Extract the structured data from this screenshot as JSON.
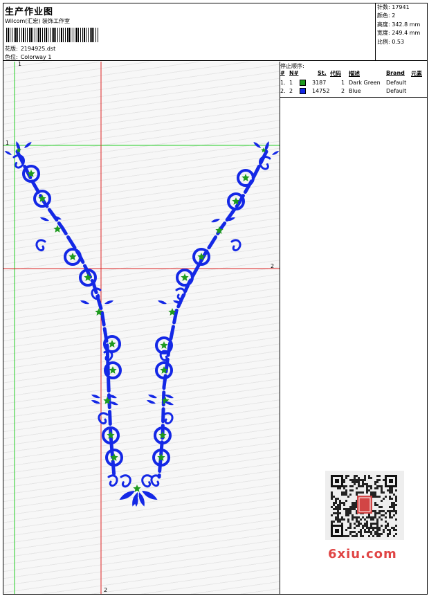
{
  "header": {
    "title": "生产作业图",
    "subtitle": "Wilcom(汇宏) 装饰工作室",
    "design_label": "花版:",
    "design_file": "2194925.dst",
    "colorway_label": "色位:",
    "colorway": "Colorway 1"
  },
  "stats": [
    {
      "label": "针数:",
      "value": "17941"
    },
    {
      "label": "颜色:",
      "value": "2"
    },
    {
      "label": "高度:",
      "value": "342.8 mm"
    },
    {
      "label": "宽度:",
      "value": "249.4 mm"
    },
    {
      "label": "比例:",
      "value": "0.53"
    }
  ],
  "stop_sequence": {
    "title": "停止顺序:",
    "columns": [
      "#",
      "N#",
      "St.",
      "代码",
      "描述",
      "Brand",
      "元素"
    ],
    "rows": [
      {
        "idx": "1.",
        "n": "1",
        "color": "#1e9a1e",
        "stitches": "3187",
        "code": "1",
        "desc": "Dark Green",
        "brand": "Default"
      },
      {
        "idx": "2.",
        "n": "2",
        "color": "#1428e6",
        "stitches": "14752",
        "code": "2",
        "desc": "Blue",
        "brand": "Default"
      }
    ]
  },
  "canvas": {
    "marker_1_top": "1",
    "marker_1_left": "1",
    "marker_2_right": "2",
    "marker_2_bottom": "2",
    "colors": {
      "blue": "#1428e6",
      "green": "#1e9a1e",
      "guide_green": "#22cc22",
      "guide_red": "#dd2222"
    }
  },
  "watermark": "6xiu.com"
}
